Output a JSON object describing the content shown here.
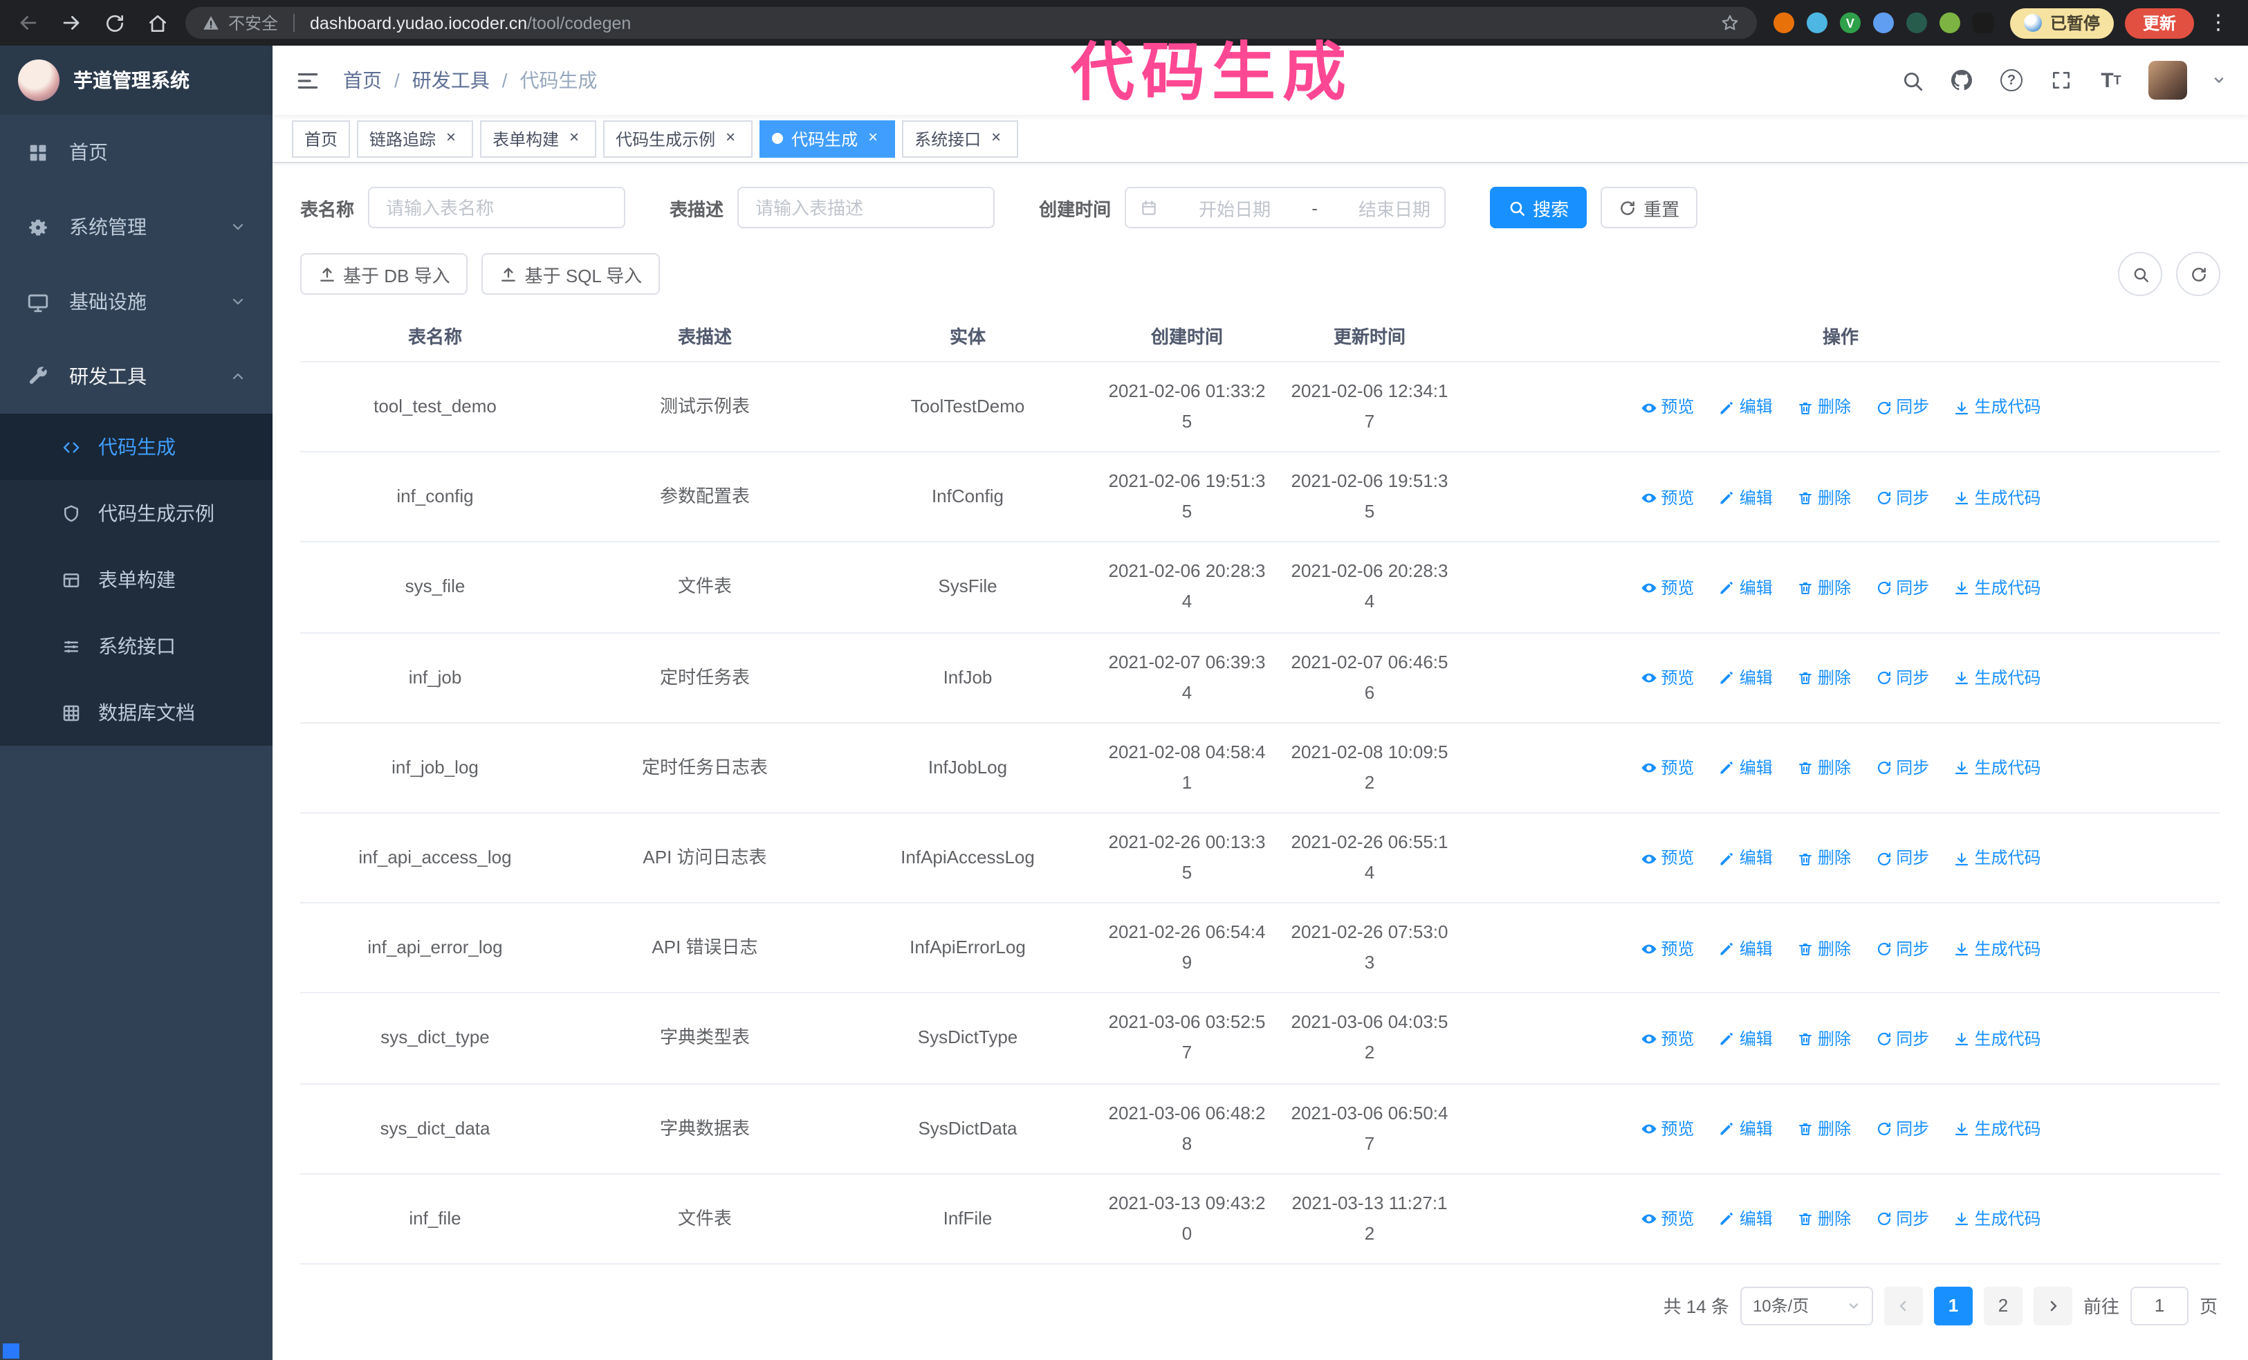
{
  "browser": {
    "security_label": "不安全",
    "url_host": "dashboard.yudao.iocoder.cn",
    "url_path": "/tool/codegen",
    "paused_label": "已暂停",
    "update_label": "更新"
  },
  "annotation": {
    "text": "代码生成",
    "color": "#ff4893"
  },
  "sidebar": {
    "logo_title": "芋道管理系统",
    "items": [
      {
        "label": "首页",
        "icon": "dashboard-icon",
        "expandable": false
      },
      {
        "label": "系统管理",
        "icon": "gear-icon",
        "expandable": true
      },
      {
        "label": "基础设施",
        "icon": "monitor-icon",
        "expandable": true
      },
      {
        "label": "研发工具",
        "icon": "wrench-icon",
        "expandable": true,
        "expanded": true
      }
    ],
    "submenu": [
      {
        "label": "代码生成",
        "icon": "code-icon",
        "active": true
      },
      {
        "label": "代码生成示例",
        "icon": "shield-icon",
        "active": false
      },
      {
        "label": "表单构建",
        "icon": "form-icon",
        "active": false
      },
      {
        "label": "系统接口",
        "icon": "sliders-icon",
        "active": false
      },
      {
        "label": "数据库文档",
        "icon": "db-grid-icon",
        "active": false
      }
    ]
  },
  "header": {
    "breadcrumb": [
      "首页",
      "研发工具",
      "代码生成"
    ]
  },
  "tabs": [
    {
      "label": "首页",
      "closable": false,
      "active": false
    },
    {
      "label": "链路追踪",
      "closable": true,
      "active": false
    },
    {
      "label": "表单构建",
      "closable": true,
      "active": false
    },
    {
      "label": "代码生成示例",
      "closable": true,
      "active": false
    },
    {
      "label": "代码生成",
      "closable": true,
      "active": true
    },
    {
      "label": "系统接口",
      "closable": true,
      "active": false
    }
  ],
  "filters": {
    "table_name_label": "表名称",
    "table_name_placeholder": "请输入表名称",
    "table_desc_label": "表描述",
    "table_desc_placeholder": "请输入表描述",
    "create_time_label": "创建时间",
    "date_start_placeholder": "开始日期",
    "date_separator": "-",
    "date_end_placeholder": "结束日期",
    "search_label": "搜索",
    "reset_label": "重置"
  },
  "toolbar": {
    "import_db_label": "基于 DB 导入",
    "import_sql_label": "基于 SQL 导入"
  },
  "table": {
    "columns": [
      "表名称",
      "表描述",
      "实体",
      "创建时间",
      "更新时间",
      "操作"
    ],
    "actions": [
      "预览",
      "编辑",
      "删除",
      "同步",
      "生成代码"
    ],
    "rows": [
      {
        "name": "tool_test_demo",
        "desc": "测试示例表",
        "entity": "ToolTestDemo",
        "create_time": "2021-02-06 01:33:25",
        "update_time": "2021-02-06 12:34:17"
      },
      {
        "name": "inf_config",
        "desc": "参数配置表",
        "entity": "InfConfig",
        "create_time": "2021-02-06 19:51:35",
        "update_time": "2021-02-06 19:51:35"
      },
      {
        "name": "sys_file",
        "desc": "文件表",
        "entity": "SysFile",
        "create_time": "2021-02-06 20:28:34",
        "update_time": "2021-02-06 20:28:34"
      },
      {
        "name": "inf_job",
        "desc": "定时任务表",
        "entity": "InfJob",
        "create_time": "2021-02-07 06:39:34",
        "update_time": "2021-02-07 06:46:56"
      },
      {
        "name": "inf_job_log",
        "desc": "定时任务日志表",
        "entity": "InfJobLog",
        "create_time": "2021-02-08 04:58:41",
        "update_time": "2021-02-08 10:09:52"
      },
      {
        "name": "inf_api_access_log",
        "desc": "API 访问日志表",
        "entity": "InfApiAccessLog",
        "create_time": "2021-02-26 00:13:35",
        "update_time": "2021-02-26 06:55:14"
      },
      {
        "name": "inf_api_error_log",
        "desc": "API 错误日志",
        "entity": "InfApiErrorLog",
        "create_time": "2021-02-26 06:54:49",
        "update_time": "2021-02-26 07:53:03"
      },
      {
        "name": "sys_dict_type",
        "desc": "字典类型表",
        "entity": "SysDictType",
        "create_time": "2021-03-06 03:52:57",
        "update_time": "2021-03-06 04:03:52"
      },
      {
        "name": "sys_dict_data",
        "desc": "字典数据表",
        "entity": "SysDictData",
        "create_time": "2021-03-06 06:48:28",
        "update_time": "2021-03-06 06:50:47"
      },
      {
        "name": "inf_file",
        "desc": "文件表",
        "entity": "InfFile",
        "create_time": "2021-03-13 09:43:20",
        "update_time": "2021-03-13 11:27:12"
      }
    ]
  },
  "pagination": {
    "total_text": "共 14 条",
    "page_size": "10条/页",
    "pages": [
      "1",
      "2"
    ],
    "active_page": "1",
    "goto_label": "前往",
    "goto_value": "1",
    "goto_suffix": "页"
  },
  "colors": {
    "primary_blue": "#1890ff",
    "tab_active_blue": "#409eff",
    "sidebar_bg": "#304156",
    "submenu_bg": "#1f2d3d",
    "annotation_pink": "#ff4893",
    "update_red": "#e25041",
    "paused_yellow": "#f7e3a1",
    "browser_bar": "#202124"
  },
  "icons": {
    "navbar": [
      "search-icon",
      "github-icon",
      "help-icon",
      "fullscreen-icon",
      "font-size-icon"
    ],
    "row_actions": [
      "eye-icon",
      "edit-icon",
      "delete-icon",
      "sync-icon",
      "download-icon"
    ]
  }
}
